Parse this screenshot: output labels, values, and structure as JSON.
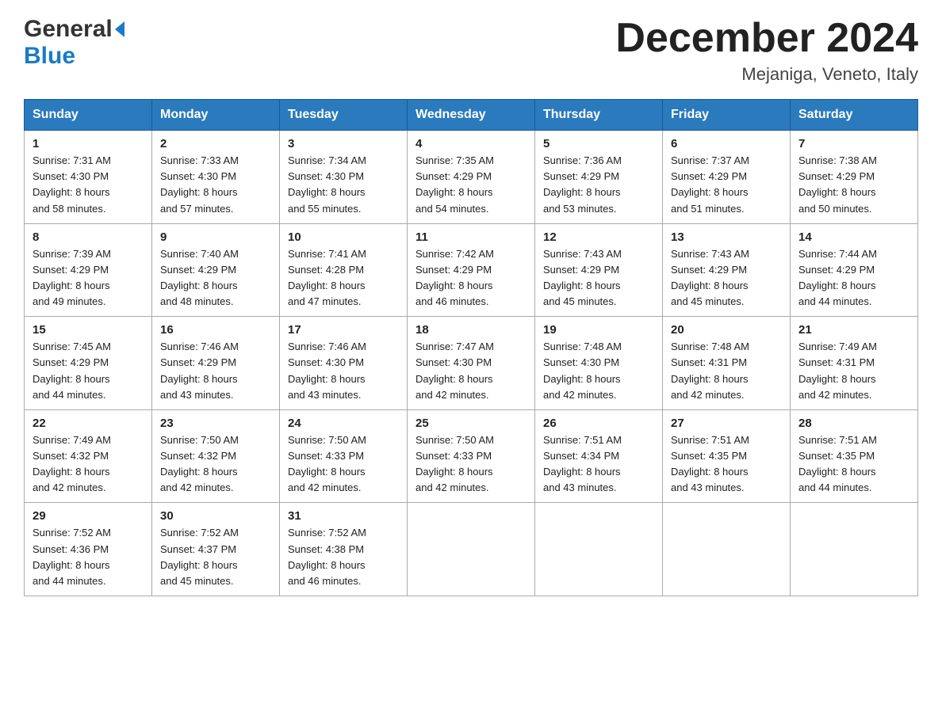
{
  "header": {
    "logo_general": "General",
    "logo_blue": "Blue",
    "month_title": "December 2024",
    "location": "Mejaniga, Veneto, Italy"
  },
  "weekdays": [
    "Sunday",
    "Monday",
    "Tuesday",
    "Wednesday",
    "Thursday",
    "Friday",
    "Saturday"
  ],
  "weeks": [
    [
      {
        "day": "1",
        "sunrise": "7:31 AM",
        "sunset": "4:30 PM",
        "daylight": "8 hours and 58 minutes."
      },
      {
        "day": "2",
        "sunrise": "7:33 AM",
        "sunset": "4:30 PM",
        "daylight": "8 hours and 57 minutes."
      },
      {
        "day": "3",
        "sunrise": "7:34 AM",
        "sunset": "4:30 PM",
        "daylight": "8 hours and 55 minutes."
      },
      {
        "day": "4",
        "sunrise": "7:35 AM",
        "sunset": "4:29 PM",
        "daylight": "8 hours and 54 minutes."
      },
      {
        "day": "5",
        "sunrise": "7:36 AM",
        "sunset": "4:29 PM",
        "daylight": "8 hours and 53 minutes."
      },
      {
        "day": "6",
        "sunrise": "7:37 AM",
        "sunset": "4:29 PM",
        "daylight": "8 hours and 51 minutes."
      },
      {
        "day": "7",
        "sunrise": "7:38 AM",
        "sunset": "4:29 PM",
        "daylight": "8 hours and 50 minutes."
      }
    ],
    [
      {
        "day": "8",
        "sunrise": "7:39 AM",
        "sunset": "4:29 PM",
        "daylight": "8 hours and 49 minutes."
      },
      {
        "day": "9",
        "sunrise": "7:40 AM",
        "sunset": "4:29 PM",
        "daylight": "8 hours and 48 minutes."
      },
      {
        "day": "10",
        "sunrise": "7:41 AM",
        "sunset": "4:28 PM",
        "daylight": "8 hours and 47 minutes."
      },
      {
        "day": "11",
        "sunrise": "7:42 AM",
        "sunset": "4:29 PM",
        "daylight": "8 hours and 46 minutes."
      },
      {
        "day": "12",
        "sunrise": "7:43 AM",
        "sunset": "4:29 PM",
        "daylight": "8 hours and 45 minutes."
      },
      {
        "day": "13",
        "sunrise": "7:43 AM",
        "sunset": "4:29 PM",
        "daylight": "8 hours and 45 minutes."
      },
      {
        "day": "14",
        "sunrise": "7:44 AM",
        "sunset": "4:29 PM",
        "daylight": "8 hours and 44 minutes."
      }
    ],
    [
      {
        "day": "15",
        "sunrise": "7:45 AM",
        "sunset": "4:29 PM",
        "daylight": "8 hours and 44 minutes."
      },
      {
        "day": "16",
        "sunrise": "7:46 AM",
        "sunset": "4:29 PM",
        "daylight": "8 hours and 43 minutes."
      },
      {
        "day": "17",
        "sunrise": "7:46 AM",
        "sunset": "4:30 PM",
        "daylight": "8 hours and 43 minutes."
      },
      {
        "day": "18",
        "sunrise": "7:47 AM",
        "sunset": "4:30 PM",
        "daylight": "8 hours and 42 minutes."
      },
      {
        "day": "19",
        "sunrise": "7:48 AM",
        "sunset": "4:30 PM",
        "daylight": "8 hours and 42 minutes."
      },
      {
        "day": "20",
        "sunrise": "7:48 AM",
        "sunset": "4:31 PM",
        "daylight": "8 hours and 42 minutes."
      },
      {
        "day": "21",
        "sunrise": "7:49 AM",
        "sunset": "4:31 PM",
        "daylight": "8 hours and 42 minutes."
      }
    ],
    [
      {
        "day": "22",
        "sunrise": "7:49 AM",
        "sunset": "4:32 PM",
        "daylight": "8 hours and 42 minutes."
      },
      {
        "day": "23",
        "sunrise": "7:50 AM",
        "sunset": "4:32 PM",
        "daylight": "8 hours and 42 minutes."
      },
      {
        "day": "24",
        "sunrise": "7:50 AM",
        "sunset": "4:33 PM",
        "daylight": "8 hours and 42 minutes."
      },
      {
        "day": "25",
        "sunrise": "7:50 AM",
        "sunset": "4:33 PM",
        "daylight": "8 hours and 42 minutes."
      },
      {
        "day": "26",
        "sunrise": "7:51 AM",
        "sunset": "4:34 PM",
        "daylight": "8 hours and 43 minutes."
      },
      {
        "day": "27",
        "sunrise": "7:51 AM",
        "sunset": "4:35 PM",
        "daylight": "8 hours and 43 minutes."
      },
      {
        "day": "28",
        "sunrise": "7:51 AM",
        "sunset": "4:35 PM",
        "daylight": "8 hours and 44 minutes."
      }
    ],
    [
      {
        "day": "29",
        "sunrise": "7:52 AM",
        "sunset": "4:36 PM",
        "daylight": "8 hours and 44 minutes."
      },
      {
        "day": "30",
        "sunrise": "7:52 AM",
        "sunset": "4:37 PM",
        "daylight": "8 hours and 45 minutes."
      },
      {
        "day": "31",
        "sunrise": "7:52 AM",
        "sunset": "4:38 PM",
        "daylight": "8 hours and 46 minutes."
      },
      null,
      null,
      null,
      null
    ]
  ],
  "labels": {
    "sunrise": "Sunrise:",
    "sunset": "Sunset:",
    "daylight": "Daylight:"
  }
}
